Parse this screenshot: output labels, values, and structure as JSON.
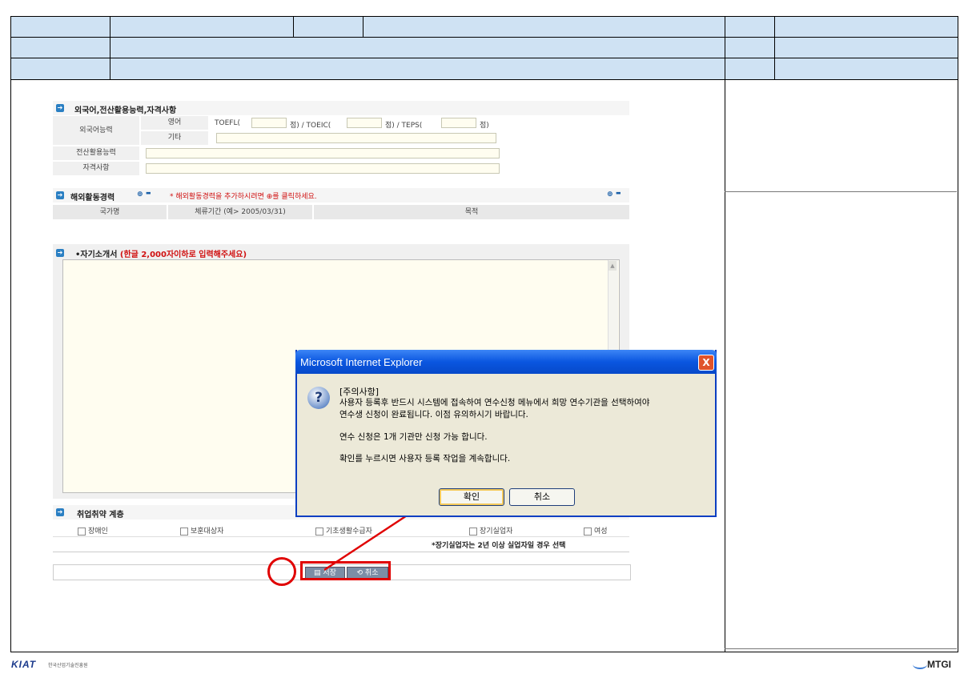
{
  "foreign": {
    "title": "외국어,전산활용능력,자격사항",
    "lang_label": "외국어능력",
    "english_label": "영어",
    "other_label": "기타",
    "toefl_prefix": "TOEFL(",
    "toeic_prefix": "점) / TOEIC(",
    "teps_prefix": "점) / TEPS(",
    "score_suffix": "점)",
    "computer_label": "전산활용능력",
    "cert_label": "자격사항"
  },
  "overseas": {
    "title": "해외활동경력",
    "hint": "* 해외활동경력을 추가하시려면 ⊕를 클릭하세요.",
    "add_icon": "⊕",
    "remove_icon": "▬",
    "col_country": "국가명",
    "col_period": "체류기간 (예> 2005/03/31)",
    "col_purpose": "목적"
  },
  "intro": {
    "title_prefix": "•자기소개서",
    "title_hint": "(한글 2,000자이하로 입력해주세요)"
  },
  "employment": {
    "title": "취업취약 계층",
    "options": [
      "장애인",
      "보훈대상자",
      "기초생활수급자",
      "장기실업자",
      "여성"
    ],
    "note": "*장기실업자는 2년 이상 실업자일 경우 선택"
  },
  "buttons": {
    "save": "저장",
    "cancel": "취소"
  },
  "dialog": {
    "title": "Microsoft Internet Explorer",
    "close": "X",
    "icon": "?",
    "line1": "[주의사항]",
    "line2": "사용자 등록후 반드시 시스템에 접속하여 연수신청 메뉴에서 희망 연수기관을 선택하여야",
    "line3": "연수생 신청이 완료됩니다. 이점 유의하시기 바랍니다.",
    "line4": "연수 신청은 1개 기관만 신청 가능 합니다.",
    "line5": "확인를 누르시면 사용자 등록 작업을 계속합니다.",
    "ok": "확인",
    "cancel": "취소"
  },
  "footer": {
    "left_logo": "KIAT",
    "left_sub": "한국산업기술진흥원",
    "right_logo": "MTGI"
  },
  "colors": {
    "header_blue": "#cfe2f3",
    "annotation_red": "#e00000",
    "dialog_title_blue": "#0a56e0"
  }
}
